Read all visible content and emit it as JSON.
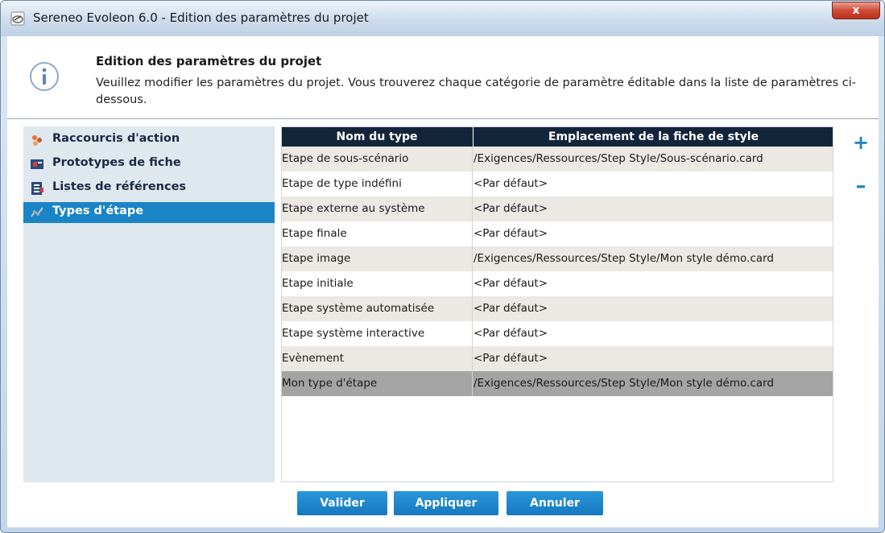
{
  "window": {
    "title": "Sereneo Evoleon 6.0 - Edition des paramètres du projet",
    "close_label": "x"
  },
  "header": {
    "title": "Edition des paramètres du projet",
    "description": "Veuillez modifier les paramètres du projet. Vous trouverez chaque catégorie de paramètre éditable dans la liste de paramètres ci-dessous.",
    "icon": "info-icon"
  },
  "sidebar": {
    "items": [
      {
        "label": "Raccourcis d'action",
        "icon": "action-shortcuts-icon",
        "selected": false
      },
      {
        "label": "Prototypes de fiche",
        "icon": "card-prototypes-icon",
        "selected": false
      },
      {
        "label": "Listes de références",
        "icon": "reference-lists-icon",
        "selected": false
      },
      {
        "label": "Types d'étape",
        "icon": "step-types-icon",
        "selected": true
      }
    ]
  },
  "table": {
    "columns": [
      "Nom du type",
      "Emplacement de la fiche de style"
    ],
    "rows": [
      {
        "name": "Etape de sous-scénario",
        "location": "/Exigences/Ressources/Step Style/Sous-scénario.card"
      },
      {
        "name": "Etape de type indéfini",
        "location": "<Par défaut>"
      },
      {
        "name": "Etape externe au système",
        "location": "<Par défaut>"
      },
      {
        "name": "Etape finale",
        "location": "<Par défaut>"
      },
      {
        "name": "Etape image",
        "location": "/Exigences/Ressources/Step Style/Mon style démo.card"
      },
      {
        "name": "Etape initiale",
        "location": "<Par défaut>"
      },
      {
        "name": "Etape système automatisée",
        "location": "<Par défaut>"
      },
      {
        "name": "Etape système interactive",
        "location": "<Par défaut>"
      },
      {
        "name": "Evènement",
        "location": "<Par défaut>"
      },
      {
        "name": "Mon type d'étape",
        "location": "/Exigences/Ressources/Step Style/Mon style démo.card"
      }
    ],
    "selected_row": 9
  },
  "side_actions": {
    "add_label": "+",
    "remove_label": "–"
  },
  "buttons": {
    "valider": "Valider",
    "appliquer": "Appliquer",
    "annuler": "Annuler"
  },
  "colors": {
    "accent": "#1a84c6",
    "table_header": "#12253b",
    "row_alt": "#ece8e3",
    "row_selected": "#a4a4a4"
  }
}
